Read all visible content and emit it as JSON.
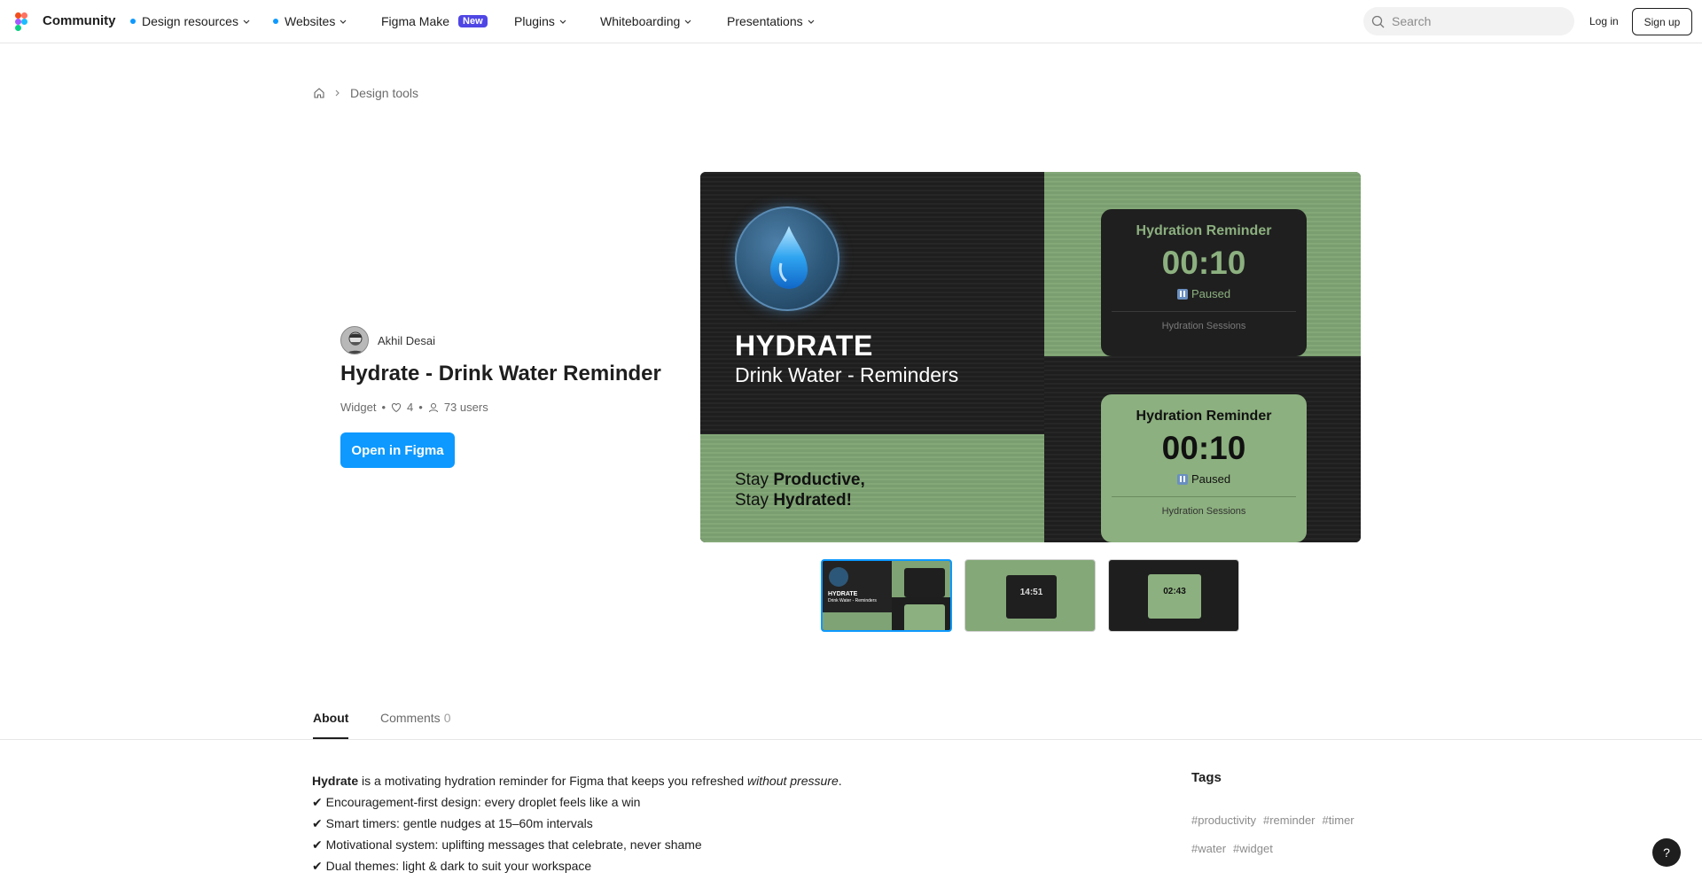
{
  "nav": {
    "brand": "Community",
    "items": [
      {
        "label": "Design resources",
        "dot": true
      },
      {
        "label": "Websites",
        "dot": true
      },
      {
        "label": "Figma Make",
        "badge": "New"
      },
      {
        "label": "Plugins"
      },
      {
        "label": "Whiteboarding"
      },
      {
        "label": "Presentations"
      }
    ],
    "search_placeholder": "Search",
    "login": "Log in",
    "signup": "Sign up"
  },
  "breadcrumb": {
    "current": "Design tools"
  },
  "product": {
    "author": "Akhil Desai",
    "title": "Hydrate - Drink Water Reminder",
    "type": "Widget",
    "likes": "4",
    "users": "73 users",
    "open_button": "Open in Figma"
  },
  "hero": {
    "heading": "HYDRATE",
    "subheading": "Drink Water - Reminders",
    "tagline_line1_pre": "Stay ",
    "tagline_line1_bold": "Productive,",
    "tagline_line2_pre": "Stay ",
    "tagline_line2_bold": "Hydrated!",
    "card_top": {
      "title": "Hydration Reminder",
      "time": "00:10",
      "status": "Paused",
      "footer": "Hydration Sessions"
    },
    "card_bottom": {
      "title": "Hydration Reminder",
      "time": "00:10",
      "status": "Paused",
      "footer": "Hydration Sessions"
    }
  },
  "thumbnails": [
    {
      "time": ""
    },
    {
      "time": "14:51"
    },
    {
      "time": "02:43"
    }
  ],
  "tabs": {
    "about": "About",
    "comments": "Comments",
    "comments_count": "0"
  },
  "about": {
    "intro_bold": "Hydrate",
    "intro_mid": " is a motivating hydration reminder for Figma that keeps you refreshed ",
    "intro_italic": "without pressure",
    "intro_end": ".",
    "points": [
      "✔ Encouragement-first design: every droplet feels like a win",
      "✔ Smart timers: gentle nudges at 15–60m intervals",
      "✔ Motivational system: uplifting messages that celebrate, never shame",
      "✔ Dual themes: light & dark to suit your workspace"
    ]
  },
  "tags": {
    "title": "Tags",
    "items": [
      "#productivity",
      "#reminder",
      "#timer",
      "#water",
      "#widget"
    ]
  },
  "help": "?"
}
